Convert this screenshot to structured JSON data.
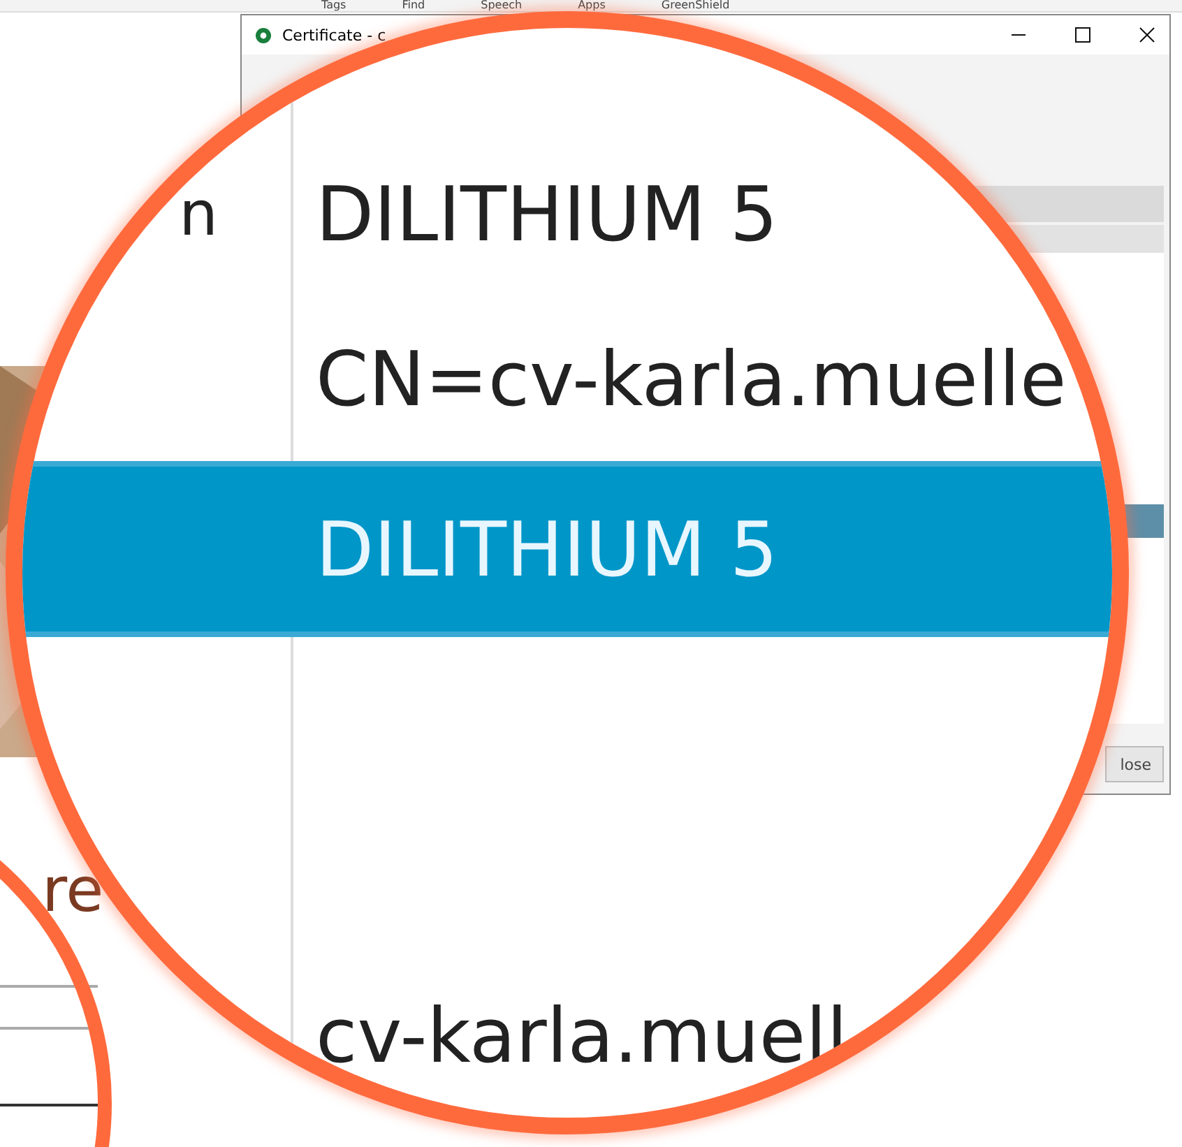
{
  "ribbon": {
    "groups": [
      "Tags",
      "Find",
      "Speech",
      "Apps",
      "GreenShield"
    ]
  },
  "window": {
    "title": "Certificate - c",
    "close_button": "lose"
  },
  "page": {
    "heading_fragment": "re"
  },
  "magnifier": {
    "rows": [
      {
        "label": "n",
        "value": "DILITHIUM 5",
        "selected": false
      },
      {
        "label": "",
        "value": "CN=cv-karla.muelle",
        "selected": false
      },
      {
        "label": "",
        "value": "DILITHIUM 5",
        "selected": true
      },
      {
        "label": "",
        "value": "cv-karla.muell",
        "selected": false
      }
    ]
  }
}
